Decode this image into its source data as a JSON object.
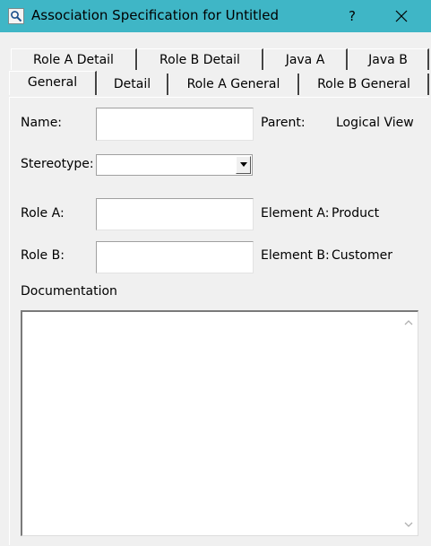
{
  "window": {
    "title": "Association Specification for Untitled",
    "help_label": "?",
    "close_label": "✕"
  },
  "tabs": {
    "row_back": [
      "Role A Detail",
      "Role B Detail",
      "Java A",
      "Java B"
    ],
    "row_front": [
      "General",
      "Detail",
      "Role A General",
      "Role B General"
    ],
    "active": "General"
  },
  "form": {
    "name_label": "Name:",
    "name_value": "",
    "parent_label": "Parent:",
    "parent_value": "Logical View",
    "stereotype_label": "Stereotype:",
    "stereotype_value": "",
    "role_a_label": "Role A:",
    "role_a_value": "",
    "element_a_label": "Element A:",
    "element_a_value": "Product",
    "role_b_label": "Role B:",
    "role_b_value": "",
    "element_b_label": "Element B:",
    "element_b_value": "Customer",
    "documentation_label": "Documentation",
    "documentation_value": ""
  },
  "icons": {
    "title_icon": "magnifier-icon",
    "dropdown_icon": "chevron-down-icon",
    "scroll_up_icon": "scroll-up-icon",
    "scroll_down_icon": "scroll-down-icon"
  },
  "colors": {
    "titlebar": "#3fb6c6",
    "dialog_background": "#f0f0f0"
  }
}
